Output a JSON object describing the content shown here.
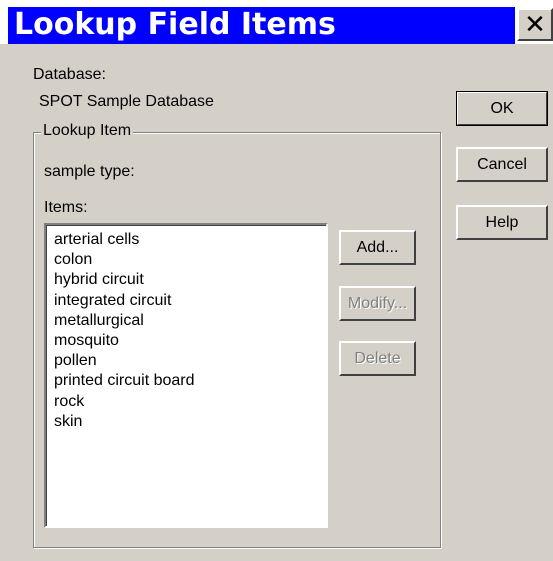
{
  "window": {
    "title": "Lookup Field Items",
    "close_glyph": "✕"
  },
  "database": {
    "label": "Database:",
    "value": "SPOT Sample Database"
  },
  "group": {
    "legend": "Lookup Item",
    "field_label": "sample type:",
    "items_label": "Items:"
  },
  "items": [
    "arterial cells",
    "colon",
    "hybrid circuit",
    "integrated circuit",
    "metallurgical",
    "mosquito",
    "pollen",
    "printed circuit board",
    "rock",
    "skin"
  ],
  "buttons": {
    "ok": "OK",
    "cancel": "Cancel",
    "help": "Help",
    "add": "Add...",
    "modify": "Modify...",
    "delete": "Delete"
  },
  "colors": {
    "title_bar": "#0000ff",
    "dialog_face": "#d4d0c8"
  }
}
